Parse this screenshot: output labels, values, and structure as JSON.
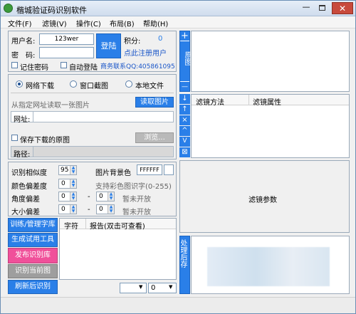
{
  "window": {
    "title": "楷城验证码识别软件"
  },
  "menu": [
    "文件(F)",
    "滤镜(V)",
    "操作(C)",
    "布局(B)",
    "帮助(H)"
  ],
  "login": {
    "username_label": "用户名:",
    "username_value": "123wer",
    "password_label": "密　码:",
    "login_button": "登陆",
    "points_label": "积分:",
    "points_value": "0",
    "register_link": "点此注册用户",
    "remember_label": "记住密码",
    "auto_login_label": "自动登陆",
    "contact": "商务联系QQ:405861095"
  },
  "source": {
    "options": [
      "网络下载",
      "窗口截图",
      "本地文件"
    ],
    "selected": "网络下载",
    "hint": "从指定网址读取一张图片",
    "read_button": "读取图片",
    "url_label": "网址:",
    "url_value": "",
    "save_label": "保存下载的原图",
    "browse_button": "浏览...",
    "path_label": "路径:",
    "path_value": ""
  },
  "params": {
    "similarity_label": "识别相似度",
    "similarity_value": "95",
    "bgcolor_label": "图片背景色",
    "bgcolor_value": "FFFFFF",
    "color_dev_label": "颜色偏差度",
    "color_dev_value": "0",
    "color_hint": "支持彩色图识字(0-255)",
    "angle_label": "角度偏差",
    "angle_from": "0",
    "angle_to": "0",
    "angle_note": "暂未开放",
    "size_label": "大小偏差",
    "size_from": "0",
    "size_to": "0",
    "size_note": "暂未开放",
    "dash": "-"
  },
  "left_buttons": [
    "训练/管理字库",
    "生成试用工具",
    "发布识别库",
    "识别当前图",
    "刷新后识别"
  ],
  "char_table": {
    "col_char": "字符",
    "col_report": "报告(双击可查看)"
  },
  "bottom": {
    "combo_value": "",
    "number_value": "0"
  },
  "right": {
    "orig_bar": {
      "plus": "+",
      "label": "原图",
      "minus": "—"
    },
    "filter_cols": {
      "method": "滤镜方法",
      "props": "滤镜属性"
    },
    "filter_tools": [
      "↓",
      "↑",
      "×",
      "^",
      "V",
      "⊠"
    ],
    "filter_params": "滤镜参数",
    "process_bar": "处理后存"
  },
  "colors": {
    "accent": "#2a7fe8",
    "pink": "#f0509a",
    "gray": "#b9b9b9"
  }
}
